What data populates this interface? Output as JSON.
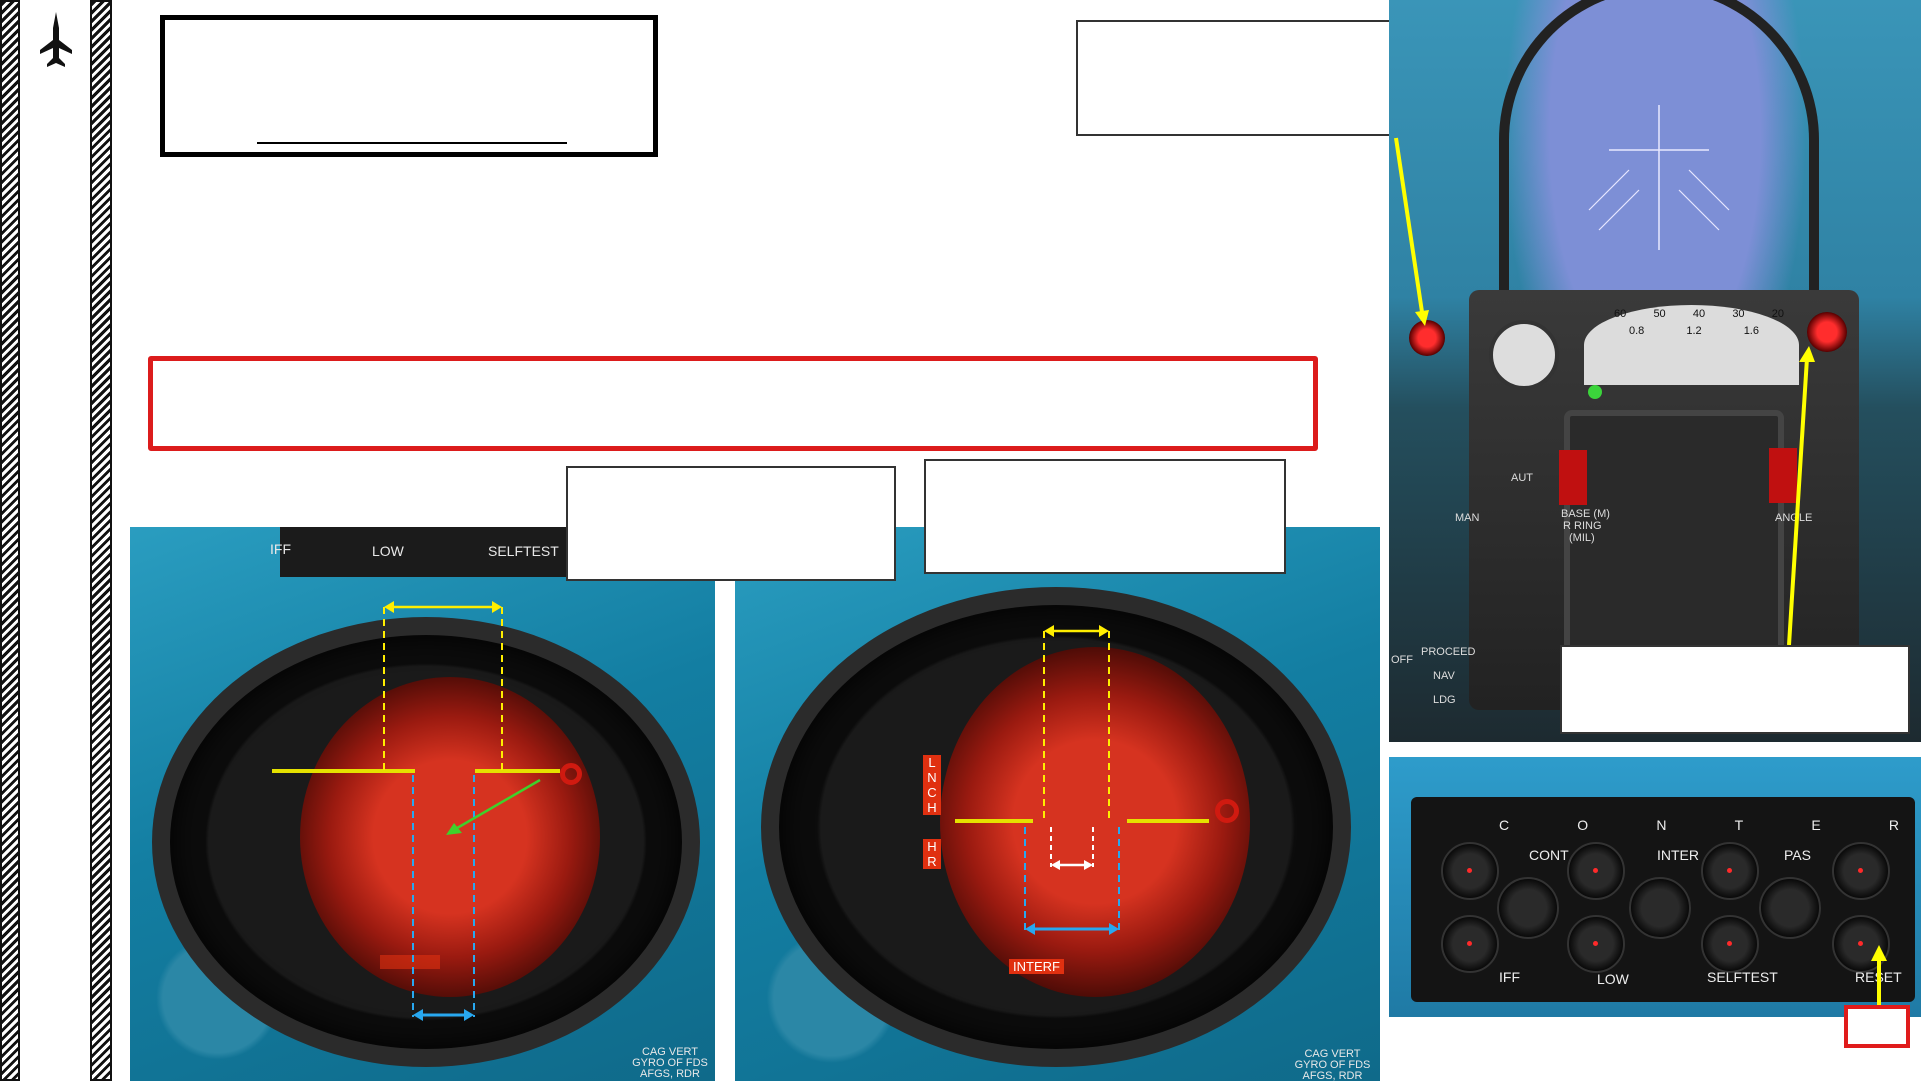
{
  "sidebar": {
    "icon": "jet-silhouette-icon"
  },
  "colors": {
    "callout_border": "#333333",
    "warning_border": "#dc1c1c",
    "arrow_yellow": "#ffff00",
    "arrow_blue": "#1fa8e8",
    "arrow_green": "#3fd12b"
  },
  "left_panel": {
    "labels": {
      "iff": "IFF",
      "low": "LOW",
      "selftest": "SELFTEST"
    },
    "caption": [
      "CAG VERT",
      "GYRO OF FDS",
      "AFGS, RDR"
    ],
    "scope_tag": ""
  },
  "middle_panel": {
    "labels": {
      "interf": "INTERF"
    },
    "vertical_tags": {
      "lnch": [
        "L",
        "N",
        "C",
        "H"
      ],
      "hr": [
        "H",
        "R"
      ]
    },
    "caption": [
      "CAG VERT",
      "GYRO OF FDS",
      "AFGS, RDR"
    ]
  },
  "cockpit_panel": {
    "gauge_numbers": [
      "60",
      "50",
      "40",
      "30",
      "20",
      "0.8",
      "1.2",
      "1.6"
    ],
    "labels": {
      "base": "BASE (M)",
      "ring": "R RING",
      "mil": "(MIL)",
      "angle": "ANGLE",
      "proceed": "PROCEED",
      "nav": "NAV",
      "ldg": "LDG",
      "off": "OFF",
      "man": "MAN",
      "aut": "AUT"
    }
  },
  "iff_panel": {
    "top_letters": [
      "C",
      "O",
      "N",
      "T",
      "E",
      "R"
    ],
    "top_labels": [
      "CONT",
      "INTER",
      "PAS"
    ],
    "bottom_labels": [
      "IFF",
      "LOW",
      "SELFTEST",
      "RESET"
    ]
  }
}
